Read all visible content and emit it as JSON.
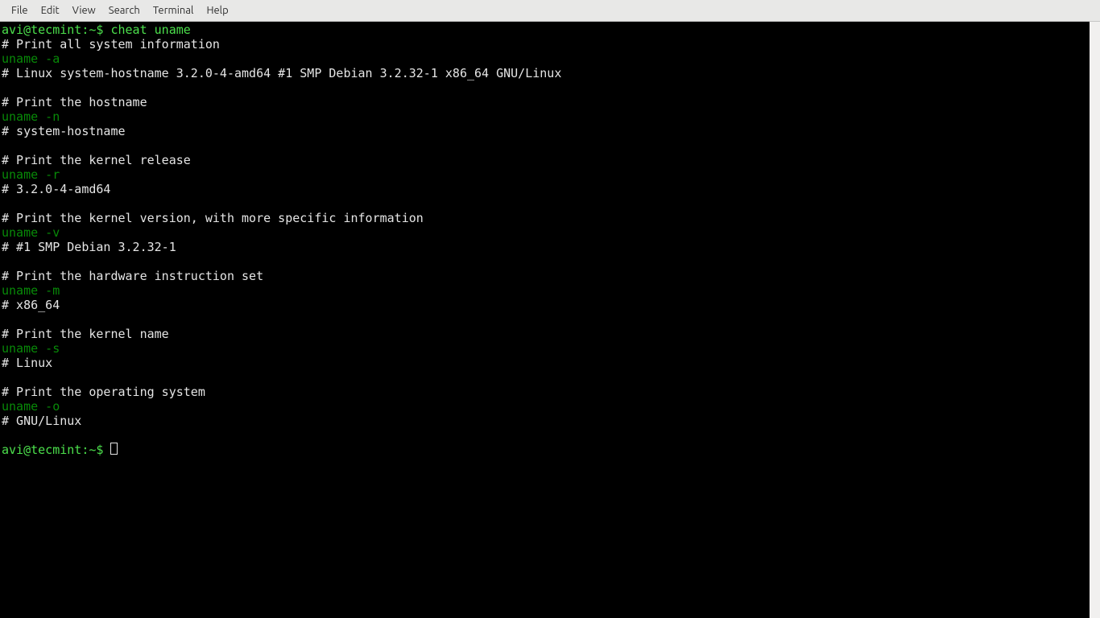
{
  "menubar": {
    "items": [
      "File",
      "Edit",
      "View",
      "Search",
      "Terminal",
      "Help"
    ]
  },
  "prompt": {
    "user_host": "avi@tecmint",
    "sep": ":",
    "cwd": "~",
    "symbol": "$"
  },
  "command1": "cheat uname",
  "sections": [
    {
      "comment": "# Print all system information",
      "cmd": "uname -a",
      "out": "# Linux system-hostname 3.2.0-4-amd64 #1 SMP Debian 3.2.32-1 x86_64 GNU/Linux"
    },
    {
      "comment": "# Print the hostname",
      "cmd": "uname -n",
      "out": "# system-hostname"
    },
    {
      "comment": "# Print the kernel release",
      "cmd": "uname -r",
      "out": "# 3.2.0-4-amd64"
    },
    {
      "comment": "# Print the kernel version, with more specific information",
      "cmd": "uname -v",
      "out": "# #1 SMP Debian 3.2.32-1"
    },
    {
      "comment": "# Print the hardware instruction set",
      "cmd": "uname -m",
      "out": "# x86_64"
    },
    {
      "comment": "# Print the kernel name",
      "cmd": "uname -s",
      "out": "# Linux"
    },
    {
      "comment": "# Print the operating system",
      "cmd": "uname -o",
      "out": "# GNU/Linux"
    }
  ]
}
